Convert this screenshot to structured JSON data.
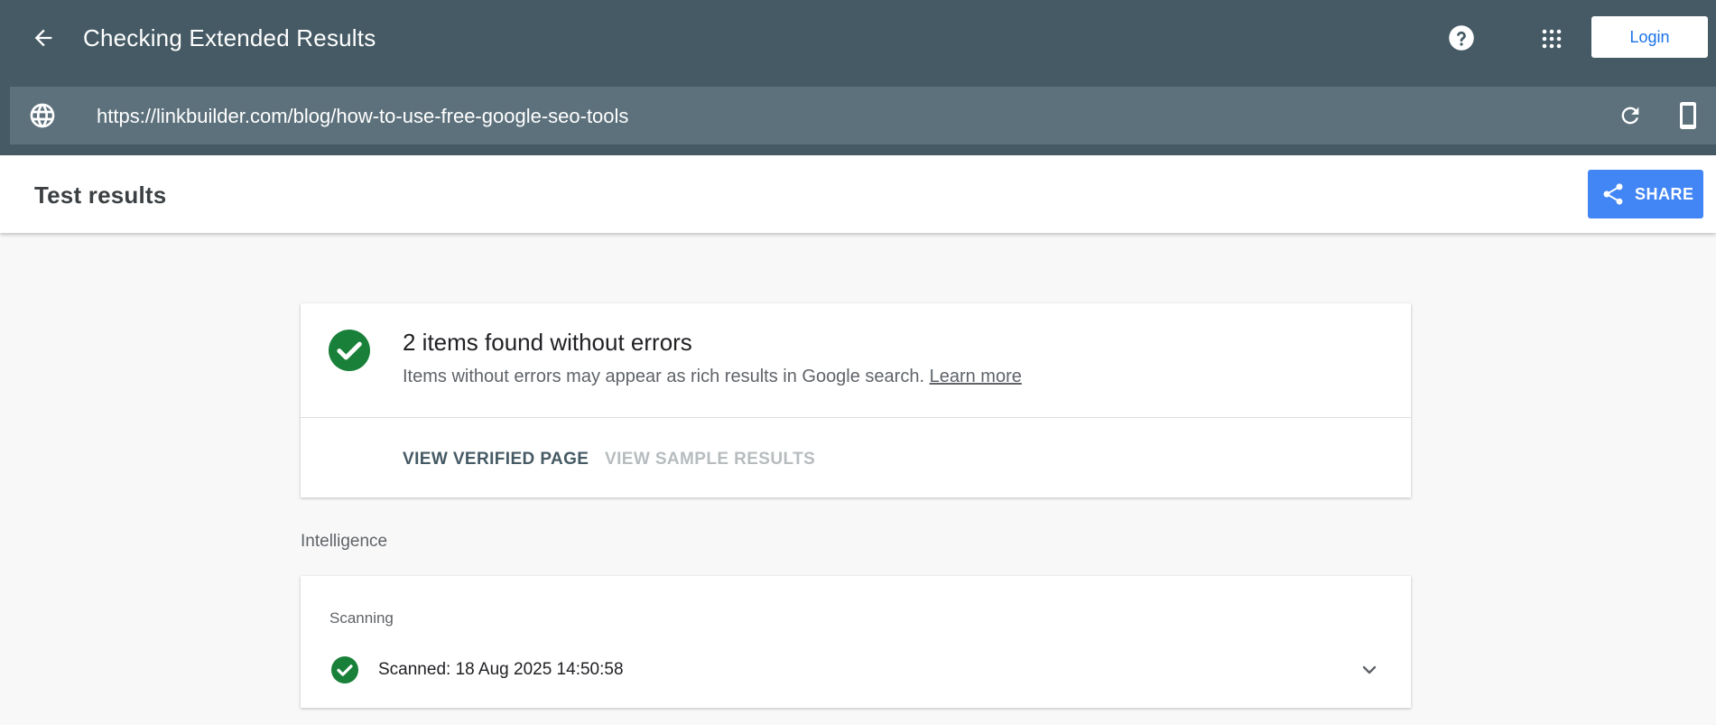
{
  "header": {
    "title": "Checking Extended Results",
    "back_icon": "arrow-back-icon",
    "help_icon": "help-circle-icon",
    "apps_icon": "apps-grid-icon",
    "login_label": "Login"
  },
  "url_bar": {
    "globe_icon": "globe-icon",
    "url": "https://linkbuilder.com/blog/how-to-use-free-google-seo-tools",
    "reload_icon": "reload-icon",
    "device_icon": "smartphone-icon"
  },
  "results_bar": {
    "title": "Test results",
    "share_label": "SHARE",
    "share_icon": "share-icon"
  },
  "summary": {
    "status_icon": "check-circle-icon",
    "heading": "2 items found without errors",
    "description": "Items without errors may appear as rich results in Google search.",
    "learn_more": "Learn more",
    "view_verified": "VIEW VERIFIED PAGE",
    "view_sample": "VIEW SAMPLE RESULTS"
  },
  "intelligence": {
    "section_label": "Intelligence",
    "card_heading": "Scanning",
    "status_icon": "check-circle-icon",
    "status_text": "Scanned: 18 Aug 2025 14:50:58",
    "expand_icon": "chevron-down-icon"
  },
  "colors": {
    "header_bg": "#455a64",
    "url_bar_bg": "#5d717c",
    "accent_blue": "#4285f4",
    "success_green": "#188038",
    "page_bg": "#f8f8f8"
  }
}
